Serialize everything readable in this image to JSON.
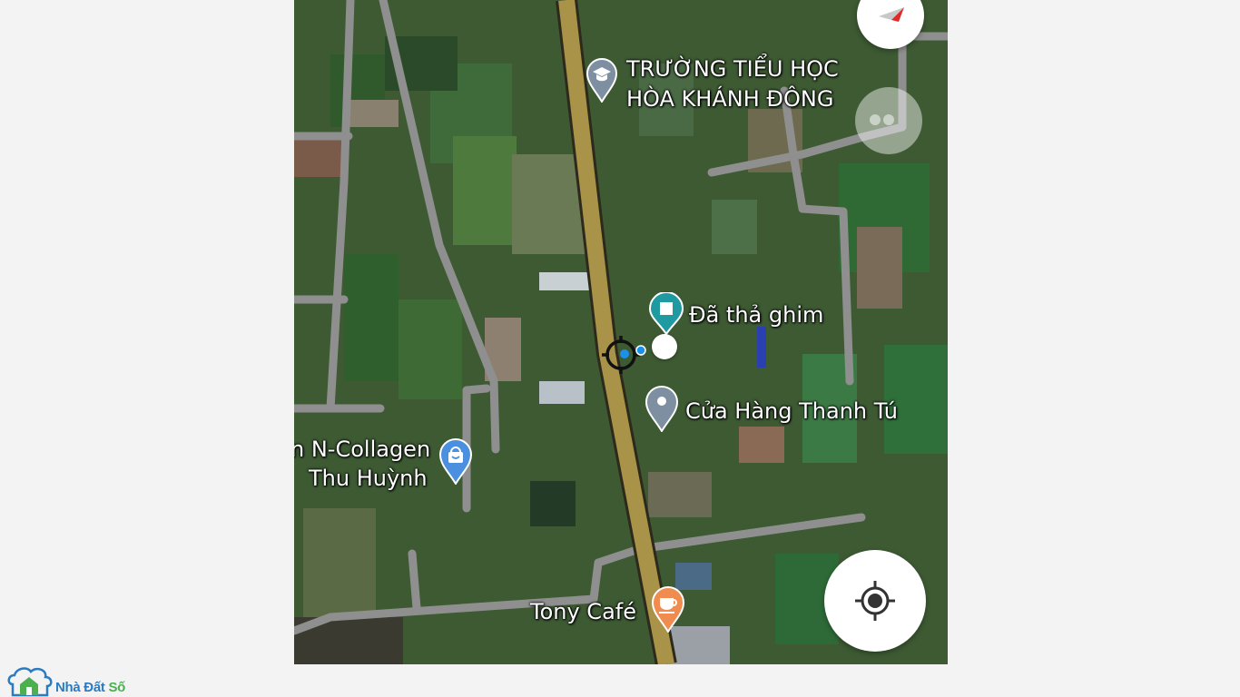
{
  "map": {
    "pois": [
      {
        "name_line1": "TRƯỜNG TIỂU HỌC",
        "name_line2": "HÒA KHÁNH ĐÔNG",
        "icon": "school-icon"
      },
      {
        "name": "Đã thả ghim",
        "icon": "dropped-pin-icon"
      },
      {
        "name": "Cửa Hàng Thanh Tú",
        "icon": "place-pin-icon"
      },
      {
        "name_line1": "n N-Collagen",
        "name_line2": "Thu Huỳnh",
        "icon": "shopping-bag-icon"
      },
      {
        "name": "Tony Café",
        "icon": "cafe-icon"
      }
    ],
    "controls": {
      "compass": "compass-icon",
      "layers": "layers-icon",
      "my_location": "my-location-icon"
    },
    "colors": {
      "main_road": "#a89348",
      "side_road": "#9a9a9a",
      "poi_teal": "#1e9aa0",
      "poi_grey": "#7d8fa0",
      "poi_blue": "#4a8fe0",
      "poi_orange": "#f08c50"
    }
  },
  "brand": {
    "name_part1": "Nhà Đất",
    "name_part2": "Số",
    "color_primary": "#2a7bbf",
    "color_accent": "#4caf50"
  }
}
